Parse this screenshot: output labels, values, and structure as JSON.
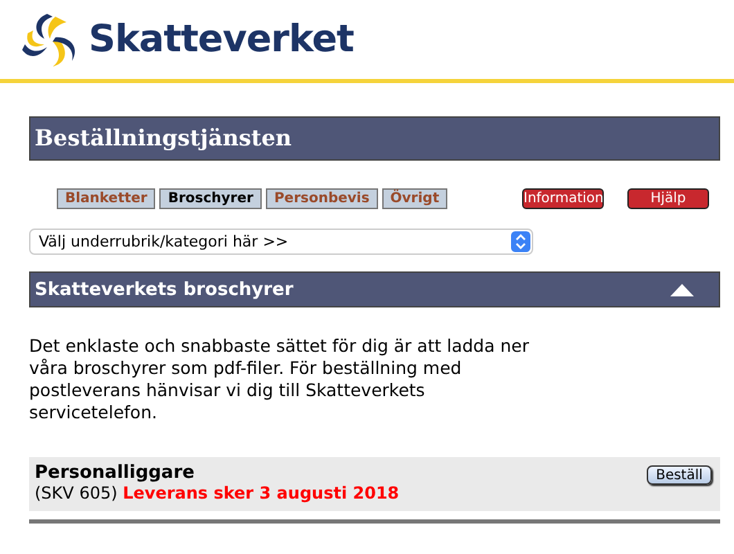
{
  "brand": {
    "name": "Skatteverket"
  },
  "page_title": "Beställningstjänsten",
  "tabs": [
    {
      "label": "Blanketter",
      "selected": false
    },
    {
      "label": "Broschyrer",
      "selected": true
    },
    {
      "label": "Personbevis",
      "selected": false
    },
    {
      "label": "Övrigt",
      "selected": false
    }
  ],
  "action_buttons": [
    "Information",
    "Hjälp"
  ],
  "category_select": {
    "value": "Välj underrubrik/kategori här >>"
  },
  "section": {
    "title": "Skatteverkets broschyrer",
    "expanded": true,
    "intro": "Det enklaste och snabbaste sättet för dig är att ladda ner våra broschyrer som pdf-filer. För beställning med postleverans hänvisar vi dig till Skatteverkets servicetelefon.",
    "items": [
      {
        "name": "Personalliggare",
        "code": "(SKV 605)",
        "note": "Leverans sker 3 augusti 2018",
        "button": "Beställ"
      }
    ]
  }
}
